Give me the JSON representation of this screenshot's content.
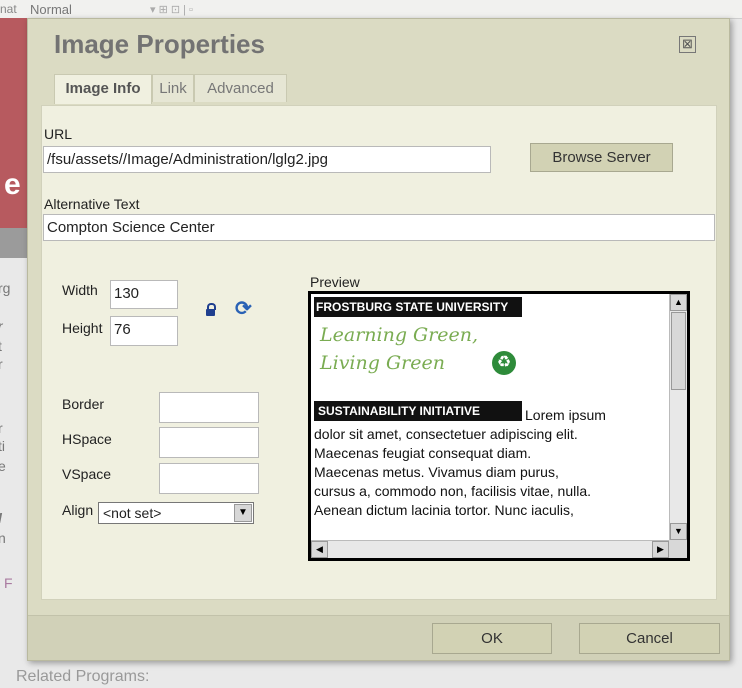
{
  "background": {
    "toolbar_fragment": "Normal",
    "toolbar_left_fragment": "nat",
    "left_letters": [
      "rg",
      "r",
      "t",
      "r",
      "r",
      "ti",
      "e",
      "l",
      "n",
      "F"
    ],
    "red_fragment": "e",
    "bottom_text": "Related Programs:"
  },
  "dialog": {
    "title": "Image Properties",
    "close_symbol": "⊠",
    "tabs": [
      {
        "label": "Image Info",
        "active": true
      },
      {
        "label": "Link",
        "active": false
      },
      {
        "label": "Advanced",
        "active": false
      }
    ],
    "url": {
      "label": "URL",
      "value": "/fsu/assets//Image/Administration/lglg2.jpg",
      "browse_label": "Browse Server"
    },
    "alt_text": {
      "label": "Alternative Text",
      "value": "Compton Science Center"
    },
    "width": {
      "label": "Width",
      "value": "130"
    },
    "height": {
      "label": "Height",
      "value": "76"
    },
    "border": {
      "label": "Border",
      "value": ""
    },
    "hspace": {
      "label": "HSpace",
      "value": ""
    },
    "vspace": {
      "label": "VSpace",
      "value": ""
    },
    "align": {
      "label": "Align",
      "value": "<not set>"
    },
    "preview": {
      "label": "Preview",
      "logo_header": "FROSTBURG STATE UNIVERSITY",
      "logo_line1": "Learning Green,",
      "logo_line2": "Living Green",
      "logo_footer": "SUSTAINABILITY  INITIATIVE",
      "text_first": "Lorem ipsum",
      "text_lines": [
        "dolor sit amet, consectetuer adipiscing elit.",
        "Maecenas feugiat consequat diam.",
        "Maecenas metus. Vivamus diam purus,",
        "cursus a, commodo non, facilisis vitae, nulla.",
        "Aenean dictum lacinia tortor. Nunc iaculis,"
      ]
    },
    "ok_label": "OK",
    "cancel_label": "Cancel"
  },
  "colors": {
    "dialog_bg": "#dbdbc3",
    "panel_bg": "#f0f0e0",
    "button_bg": "#d2d2b4",
    "title": "#737373"
  }
}
